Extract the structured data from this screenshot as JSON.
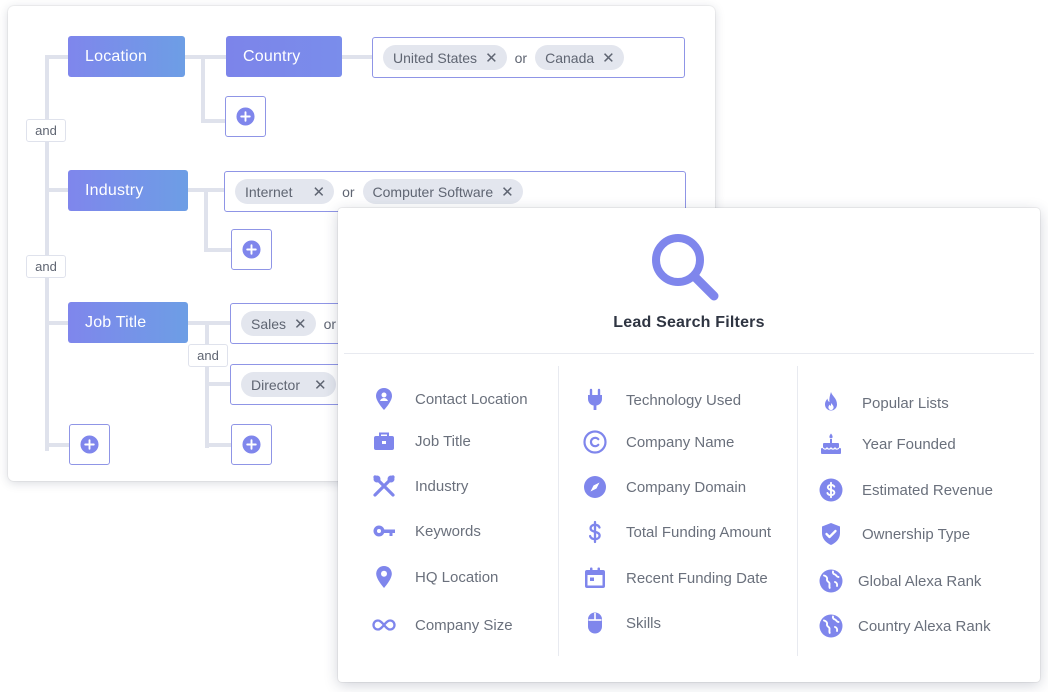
{
  "builder": {
    "location": {
      "label": "Location"
    },
    "country": {
      "label": "Country",
      "chips": [
        "United States",
        "Canada"
      ],
      "or": "or"
    },
    "industry": {
      "label": "Industry",
      "chips": [
        "Internet",
        "Computer Software"
      ],
      "or": "or"
    },
    "job_title": {
      "label": "Job Title",
      "chips_row1": [
        "Sales"
      ],
      "or_partial": "or",
      "chips_row2": [
        "Director"
      ]
    },
    "and_labels": [
      "and",
      "and",
      "and"
    ],
    "chip_close": "✕"
  },
  "filters_panel": {
    "title": "Lead Search Filters",
    "accent_color": "#7f86ec",
    "columns": [
      [
        {
          "label": "Contact Location",
          "icon": "map-pin-person-icon"
        },
        {
          "label": "Job Title",
          "icon": "briefcase-icon"
        },
        {
          "label": "Industry",
          "icon": "tools-icon"
        },
        {
          "label": "Keywords",
          "icon": "key-icon"
        },
        {
          "label": "HQ Location",
          "icon": "map-pin-icon"
        },
        {
          "label": "Company Size",
          "icon": "infinity-icon"
        }
      ],
      [
        {
          "label": "Technology Used",
          "icon": "plug-icon"
        },
        {
          "label": "Company Name",
          "icon": "copyright-icon"
        },
        {
          "label": "Company Domain",
          "icon": "compass-icon"
        },
        {
          "label": "Total Funding Amount",
          "icon": "dollar-icon"
        },
        {
          "label": "Recent Funding Date",
          "icon": "calendar-icon"
        },
        {
          "label": "Skills",
          "icon": "mouse-icon"
        }
      ],
      [
        {
          "label": "Popular Lists",
          "icon": "flame-icon"
        },
        {
          "label": "Year Founded",
          "icon": "cake-icon"
        },
        {
          "label": "Estimated Revenue",
          "icon": "dollar-circle-icon"
        },
        {
          "label": "Ownership Type",
          "icon": "shield-check-icon"
        },
        {
          "label": "Global Alexa Rank",
          "icon": "globe-icon"
        },
        {
          "label": "Country Alexa Rank",
          "icon": "globe-icon"
        }
      ]
    ]
  }
}
